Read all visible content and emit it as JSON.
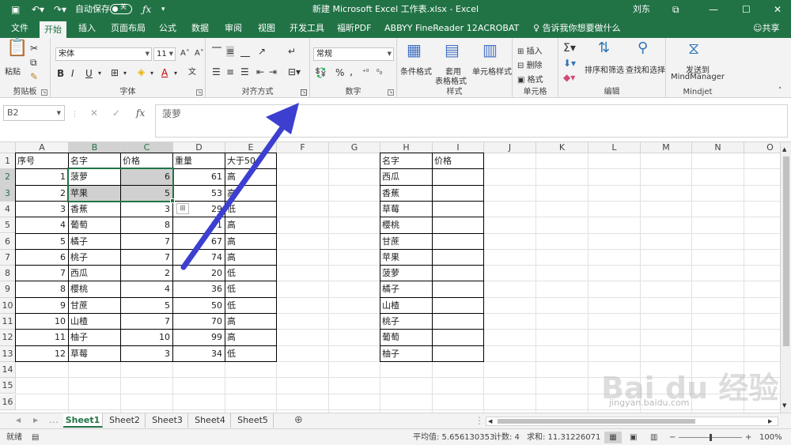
{
  "window": {
    "title": "新建 Microsoft Excel 工作表.xlsx  -  Excel",
    "user": "刘东",
    "autosave_label": "自动保存",
    "autosave_state": "关"
  },
  "tabs": [
    "文件",
    "开始",
    "插入",
    "页面布局",
    "公式",
    "数据",
    "审阅",
    "视图",
    "开发工具",
    "福昕PDF",
    "ABBYY FineReader 12",
    "ACROBAT"
  ],
  "active_tab": "开始",
  "tell_me": "告诉我你想要做什么",
  "share": "共享",
  "ribbon": {
    "clipboard": {
      "paste": "粘贴",
      "label": "剪贴板"
    },
    "font": {
      "name": "宋体",
      "size": "11",
      "bold": "B",
      "italic": "I",
      "underline": "U",
      "label": "字体"
    },
    "alignment": {
      "label": "对齐方式"
    },
    "number": {
      "format": "常规",
      "percent": "%",
      "label": "数字"
    },
    "styles": {
      "conditional": "条件格式",
      "table1": "套用",
      "table2": "表格格式",
      "cell": "单元格样式",
      "label": "样式"
    },
    "cells": {
      "insert": "插入",
      "delete": "删除",
      "format": "格式",
      "label": "单元格"
    },
    "editing": {
      "sort": "排序和筛选",
      "find": "查找和选择",
      "label": "编辑"
    },
    "mindjet": {
      "send1": "发送到",
      "send2": "MindManager",
      "label": "Mindjet"
    }
  },
  "formula_bar": {
    "name_box": "B2",
    "formula": "菠萝",
    "cancel": "✕",
    "enter": "✓",
    "fx": "fx"
  },
  "columns": [
    "A",
    "B",
    "C",
    "D",
    "E",
    "F",
    "G",
    "H",
    "I",
    "J",
    "K",
    "L",
    "M",
    "N",
    "O"
  ],
  "rows": [
    "1",
    "2",
    "3",
    "4",
    "5",
    "6",
    "7",
    "8",
    "9",
    "10",
    "11",
    "12",
    "13",
    "14",
    "15",
    "16"
  ],
  "table1": {
    "headers": [
      "序号",
      "名字",
      "价格",
      "重量",
      "大于50"
    ],
    "rows": [
      [
        "1",
        "菠萝",
        "6",
        "61",
        "高"
      ],
      [
        "2",
        "苹果",
        "5",
        "53",
        "高"
      ],
      [
        "3",
        "香蕉",
        "3",
        "29",
        "低"
      ],
      [
        "4",
        "葡萄",
        "8",
        "31",
        "高"
      ],
      [
        "5",
        "橘子",
        "7",
        "67",
        "高"
      ],
      [
        "6",
        "桃子",
        "7",
        "74",
        "高"
      ],
      [
        "7",
        "西瓜",
        "2",
        "20",
        "低"
      ],
      [
        "8",
        "樱桃",
        "4",
        "36",
        "低"
      ],
      [
        "9",
        "甘蔗",
        "5",
        "50",
        "低"
      ],
      [
        "10",
        "山楂",
        "7",
        "70",
        "高"
      ],
      [
        "11",
        "柚子",
        "10",
        "99",
        "高"
      ],
      [
        "12",
        "草莓",
        "3",
        "34",
        "低"
      ]
    ]
  },
  "table2": {
    "headers": [
      "名字",
      "价格"
    ],
    "rows": [
      "西瓜",
      "香蕉",
      "草莓",
      "樱桃",
      "甘蔗",
      "苹果",
      "菠萝",
      "橘子",
      "山楂",
      "桃子",
      "葡萄",
      "柚子"
    ]
  },
  "sheets": [
    "Sheet1",
    "Sheet2",
    "Sheet3",
    "Sheet4",
    "Sheet5"
  ],
  "active_sheet": "Sheet1",
  "status": {
    "mode": "就绪",
    "average": "平均值: 5.656130353",
    "count": "计数: 4",
    "sum": "求和: 11.31226071",
    "zoom": "100%"
  },
  "watermark": {
    "logo": "Bai du 经验",
    "url": "jingyan.baidu.com"
  },
  "colors": {
    "accent": "#217346",
    "arrow": "#3c3fcf"
  }
}
